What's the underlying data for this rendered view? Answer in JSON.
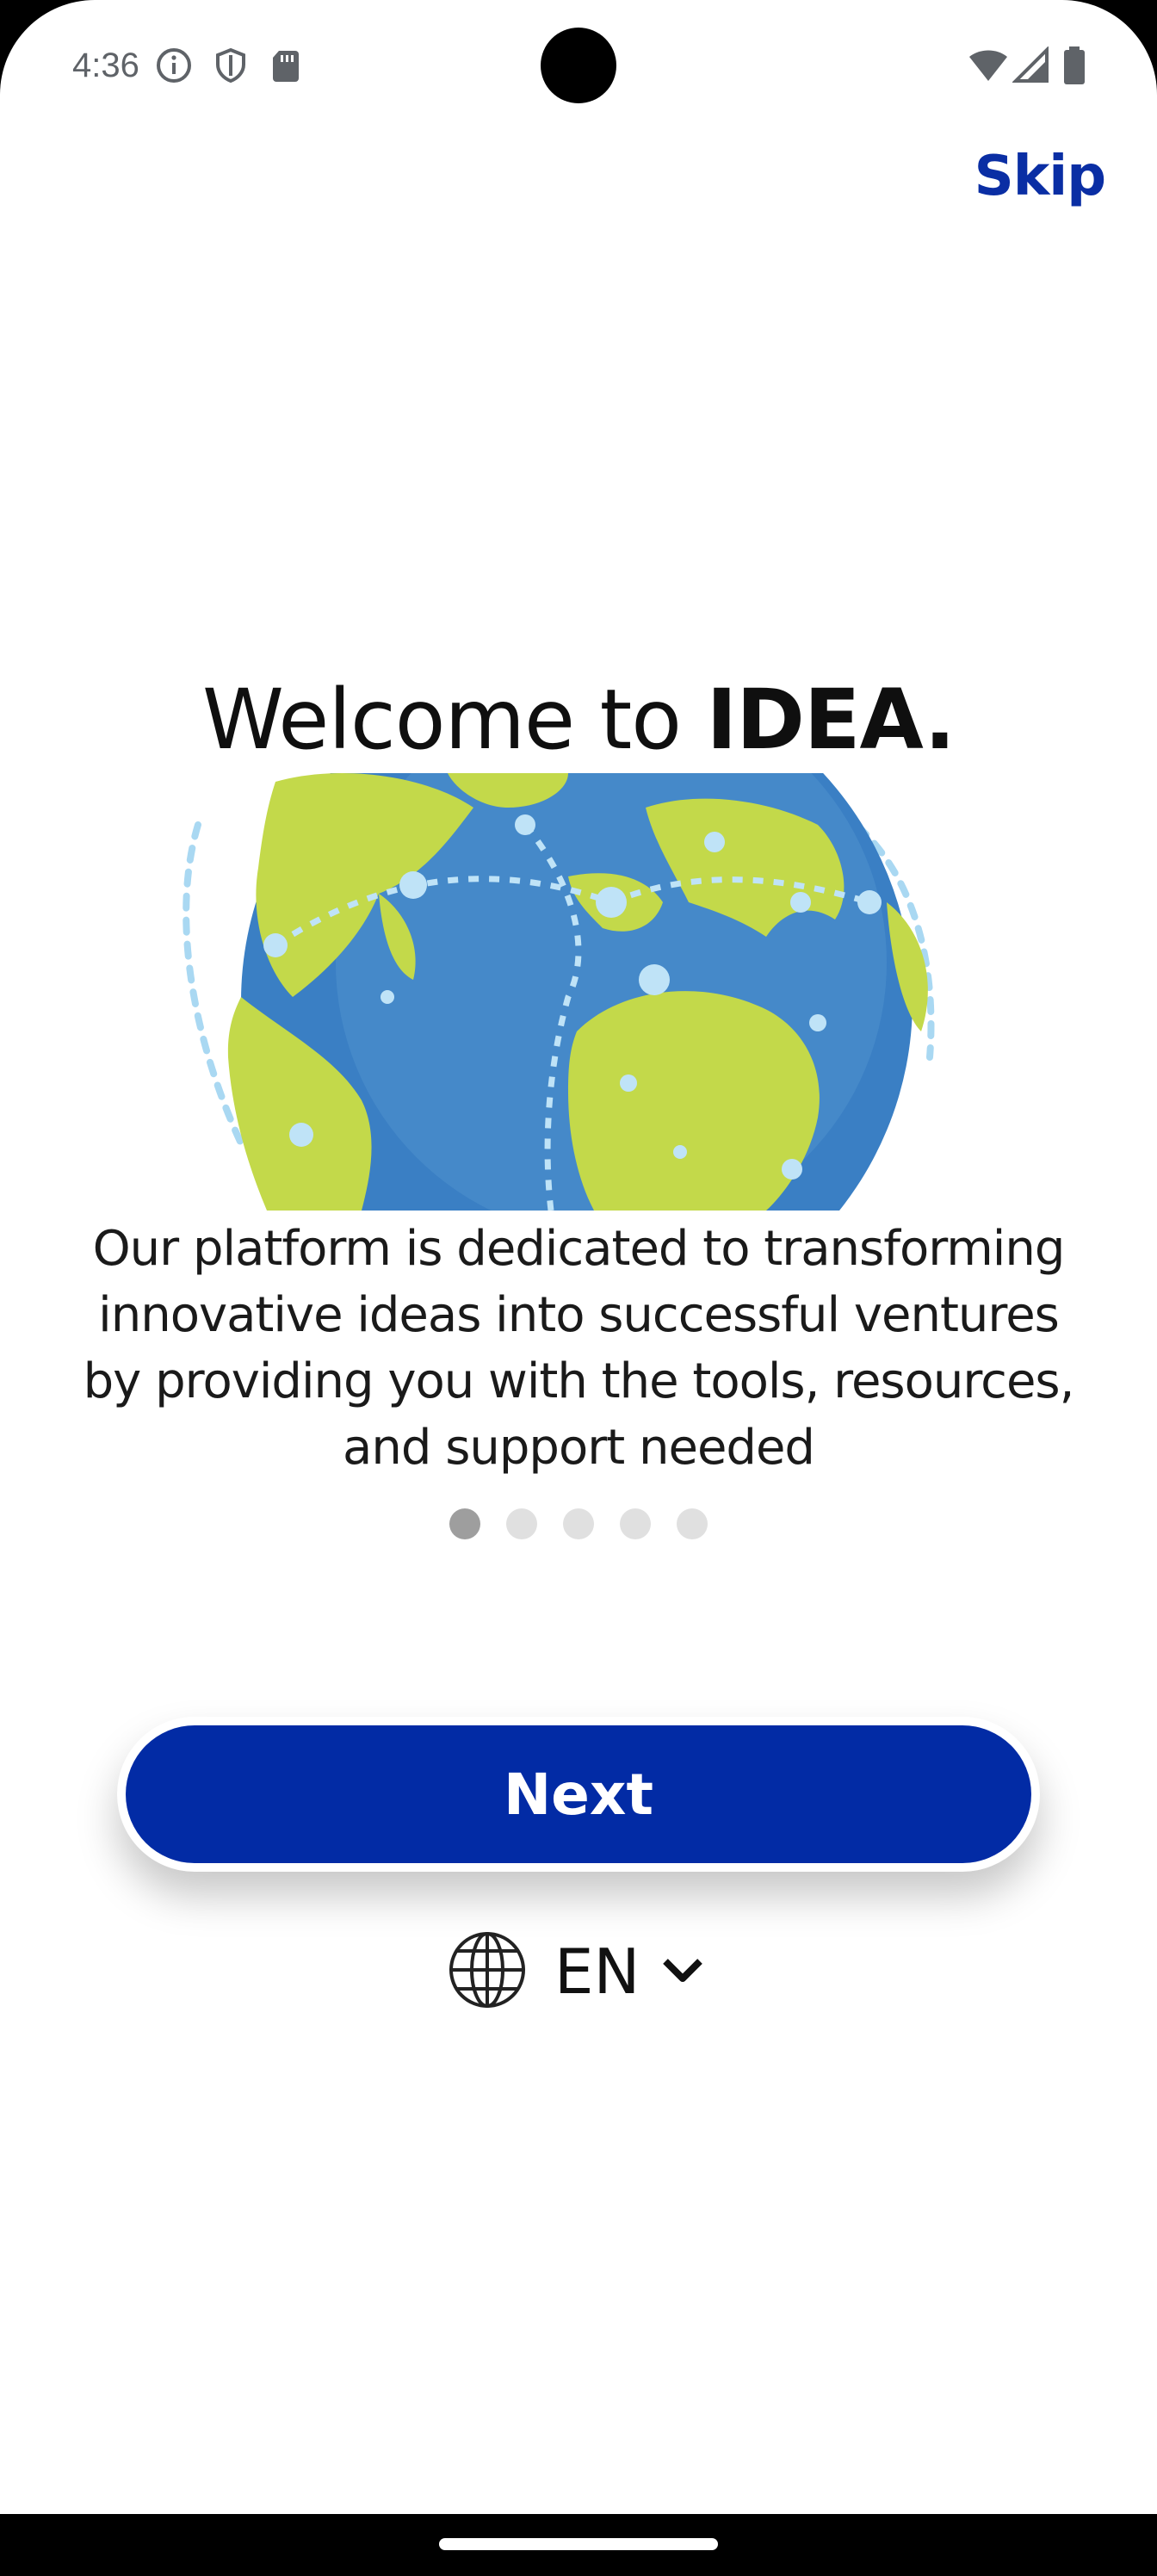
{
  "status_bar": {
    "time": "4:36",
    "left_icons": [
      "info-icon",
      "shield-icon",
      "sd-card-icon"
    ],
    "right_icons": [
      "wifi-icon",
      "signal-icon",
      "battery-icon"
    ]
  },
  "header": {
    "skip_label": "Skip"
  },
  "onboarding": {
    "title_prefix": "Welcome to ",
    "title_brand": "IDEA.",
    "image_icon": "globe-illustration",
    "description": "Our platform is dedicated to transforming innovative ideas into successful ventures by providing you with the tools, resources, and support needed",
    "page_indicator": {
      "total": 5,
      "current": 1
    }
  },
  "actions": {
    "next_label": "Next"
  },
  "language": {
    "selected": "EN",
    "icon": "globe-icon"
  },
  "colors": {
    "brand_blue": "#022ba5",
    "skip_blue": "#0a2ea4",
    "dot_active": "#9e9e9e",
    "dot_inactive": "#e0e0e0",
    "globe_ocean": "#3a7fc4",
    "globe_land": "#c3d94a"
  }
}
